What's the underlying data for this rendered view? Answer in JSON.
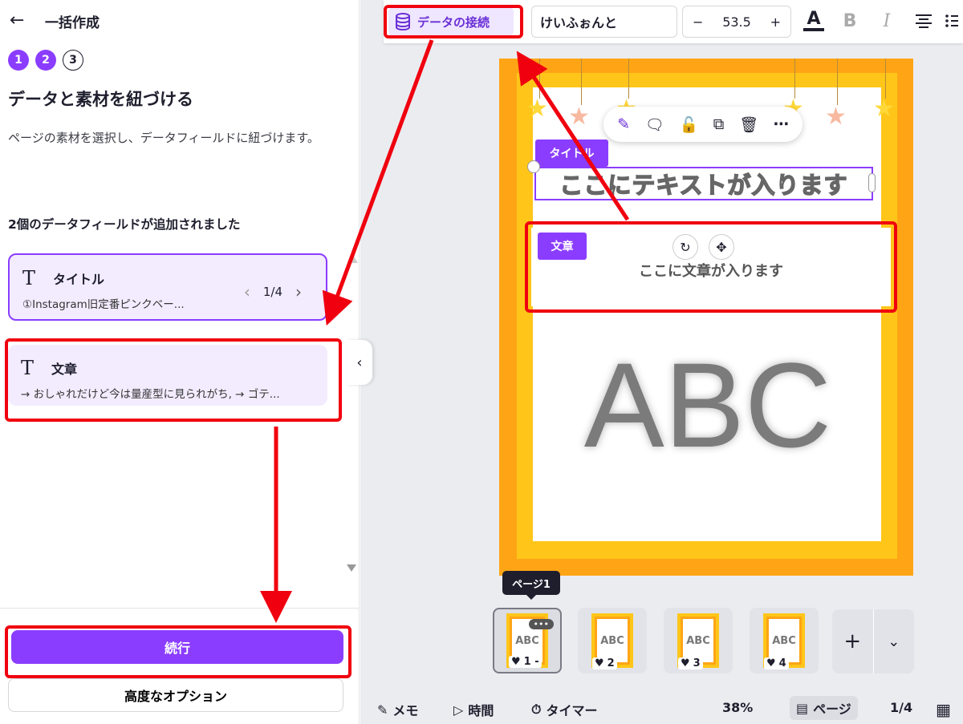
{
  "left_panel": {
    "title": "一括作成",
    "steps": [
      "1",
      "2",
      "3"
    ],
    "heading": "データと素材を紐づける",
    "description": "ページの素材を選択し、データフィールドに紐づけます。",
    "added_count_text": "2個のデータフィールドが追加されました",
    "fields": [
      {
        "name": "タイトル",
        "preview": "①Instagram旧定番ピンクベー...",
        "pager": "1/4"
      },
      {
        "name": "文章",
        "preview": "→ おしゃれだけど今は量産型に見られがち, → ゴテ..."
      }
    ],
    "continue_label": "続行",
    "advanced_label": "高度なオプション"
  },
  "toolbar": {
    "data_connect_label": "データの接続",
    "font_name": "けいふぉんと",
    "font_size": "53.5",
    "minus": "−",
    "plus": "+"
  },
  "canvas": {
    "title_tag": "タイトル",
    "title_text": "ここにテキストが入ります",
    "body_tag": "文章",
    "body_text": "ここに文章が入ります",
    "abc_text": "ABC"
  },
  "pages": {
    "tooltip": "ページ1",
    "thumbs": [
      {
        "num": "1 -",
        "label": "ABC"
      },
      {
        "num": "2",
        "label": "ABC"
      },
      {
        "num": "3",
        "label": "ABC"
      },
      {
        "num": "4",
        "label": "ABC"
      }
    ]
  },
  "bottom_bar": {
    "memo": "メモ",
    "time": "時間",
    "timer": "タイマー",
    "zoom": "38%",
    "page_view": "ページ",
    "page_count": "1/4"
  },
  "colors": {
    "accent": "#8b3dff",
    "annotation_red": "#f0000e",
    "page_orange": "#ffa515",
    "page_yellow": "#ffc619"
  }
}
